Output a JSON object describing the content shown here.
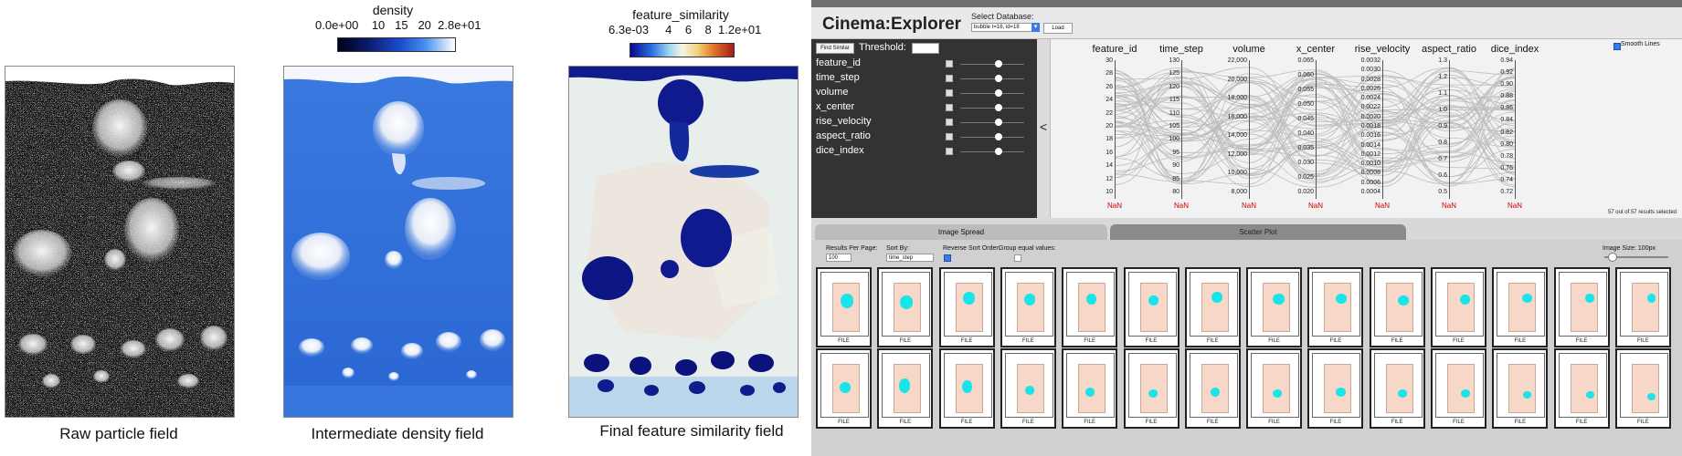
{
  "figure": {
    "captions": {
      "raw": "Raw particle field",
      "density": "Intermediate density field",
      "similarity": "Final feature similarity field"
    },
    "density_colorbar": {
      "title": "density",
      "ticks": [
        "0.0e+00",
        "10",
        "15",
        "20",
        "2.8e+01"
      ]
    },
    "similarity_colorbar": {
      "title": "feature_similarity",
      "ticks": [
        "6.3e-03",
        "4",
        "6",
        "8",
        "1.2e+01"
      ]
    }
  },
  "explorer": {
    "title": "Cinema:Explorer",
    "select_database_label": "Select Database:",
    "database_value": "bubble t=16, id=18",
    "load_button": "Load",
    "find_similar_button": "Find Similar",
    "threshold_label": "Threshold:",
    "threshold_value": "",
    "collapse_symbol": "<",
    "smooth_lines_label": "Smooth Lines",
    "smooth_lines_checked": true,
    "variables": [
      "feature_id",
      "time_step",
      "volume",
      "x_center",
      "rise_velocity",
      "aspect_ratio",
      "dice_index"
    ],
    "axes": [
      {
        "name": "feature_id",
        "ticks": [
          "30",
          "28",
          "26",
          "24",
          "22",
          "20",
          "18",
          "16",
          "14",
          "12",
          "10"
        ]
      },
      {
        "name": "time_step",
        "ticks": [
          "130",
          "125",
          "120",
          "115",
          "110",
          "105",
          "100",
          "95",
          "90",
          "85",
          "80"
        ]
      },
      {
        "name": "volume",
        "ticks": [
          "22,000",
          "20,000",
          "18,000",
          "16,000",
          "14,000",
          "12,000",
          "10,000",
          "8,000"
        ]
      },
      {
        "name": "x_center",
        "ticks": [
          "0.065",
          "0.060",
          "0.055",
          "0.050",
          "0.045",
          "0.040",
          "0.035",
          "0.030",
          "0.025",
          "0.020"
        ]
      },
      {
        "name": "rise_velocity",
        "ticks": [
          "0.0032",
          "0.0030",
          "0.0028",
          "0.0026",
          "0.0024",
          "0.0022",
          "0.0020",
          "0.0018",
          "0.0016",
          "0.0014",
          "0.0012",
          "0.0010",
          "0.0008",
          "0.0006",
          "0.0004"
        ]
      },
      {
        "name": "aspect_ratio",
        "ticks": [
          "1.3",
          "1.2",
          "1.1",
          "1.0",
          "0.9",
          "0.8",
          "0.7",
          "0.6",
          "0.5"
        ]
      },
      {
        "name": "dice_index",
        "ticks": [
          "0.94",
          "0.92",
          "0.90",
          "0.88",
          "0.86",
          "0.84",
          "0.82",
          "0.80",
          "0.78",
          "0.76",
          "0.74",
          "0.72"
        ]
      }
    ],
    "nan_label": "NaN",
    "results_selected": "57 out of 57 results selected",
    "tabs": [
      "Image Spread",
      "Scatter Plot"
    ],
    "results_per_page_label": "Results Per Page:",
    "results_per_page_value": "100",
    "sort_by_label": "Sort By:",
    "sort_by_value": "time_step",
    "reverse_sort_label": "Reverse Sort Order:",
    "reverse_sort_checked": true,
    "group_equal_label": "Group equal values:",
    "group_equal_checked": false,
    "image_size_label": "Image Size: 100px",
    "image_size_value": 100,
    "tile_label": "FILE",
    "tile_rows": 2,
    "tile_cols": 14,
    "colors": {
      "header_bg": "#e9e9e9",
      "left_panel_bg": "#333333",
      "highlight_blob": "#19e4ea",
      "tile_rect": "#f7d8c8",
      "nan": "#cc0000"
    }
  }
}
